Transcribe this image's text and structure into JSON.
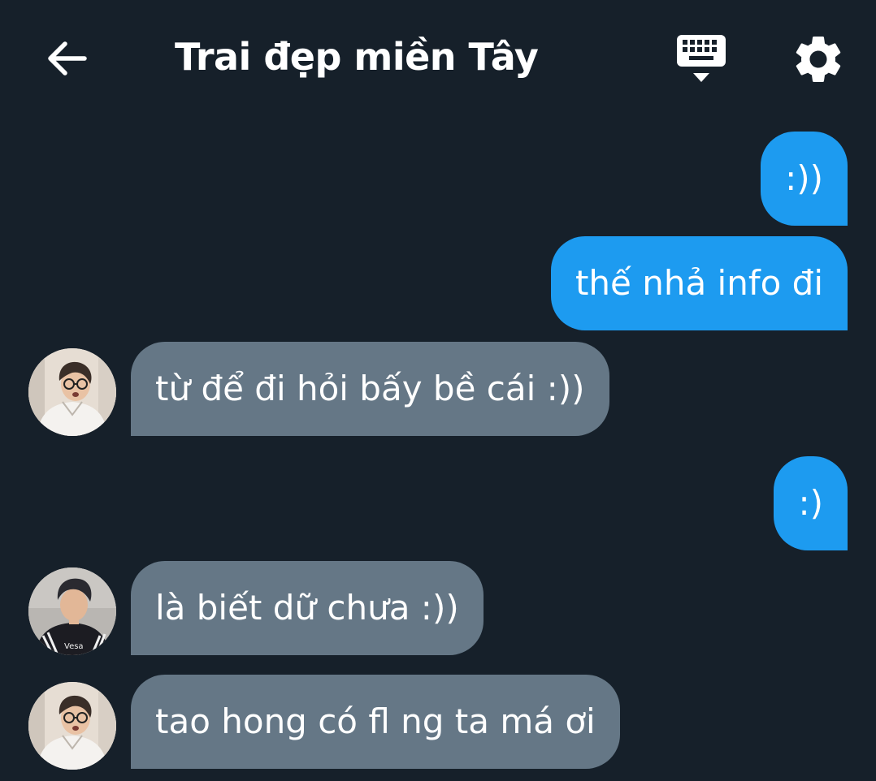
{
  "header": {
    "title": "Trai đẹp miền Tây",
    "back_icon": "arrow-left-icon",
    "keyboard_icon": "keyboard-hide-icon",
    "settings_icon": "gear-icon"
  },
  "colors": {
    "background": "#16202a",
    "outgoing_bubble": "#1d9bf0",
    "incoming_bubble": "#657786",
    "text": "#ffffff"
  },
  "messages": [
    {
      "direction": "outgoing",
      "text": ":))"
    },
    {
      "direction": "outgoing",
      "text": "thế nhả info đi"
    },
    {
      "direction": "incoming",
      "text": "từ để đi hỏi bấy bề cái :))",
      "avatar": "avatar-person-glasses"
    },
    {
      "direction": "outgoing",
      "text": ":)"
    },
    {
      "direction": "incoming",
      "text": "là biết dữ chưa :))",
      "avatar": "avatar-person-striped-shirt"
    },
    {
      "direction": "incoming",
      "text": "tao hong có fl ng ta má ơi",
      "avatar": "avatar-person-glasses"
    }
  ]
}
